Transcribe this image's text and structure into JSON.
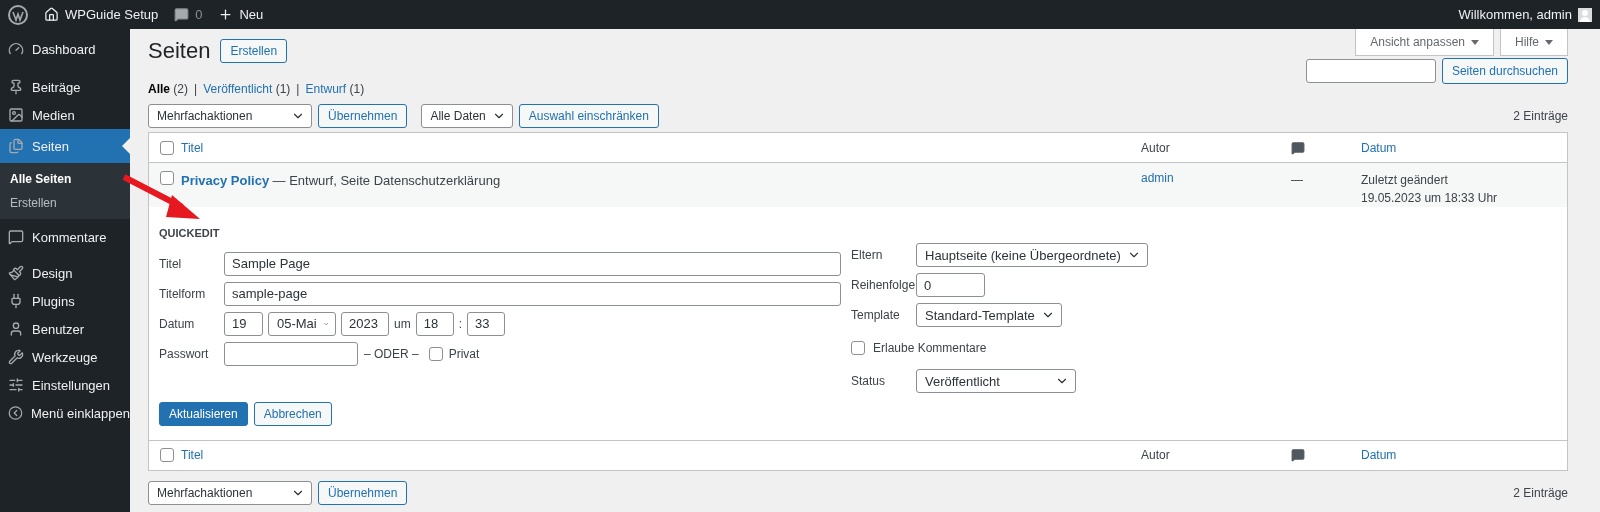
{
  "admin_bar": {
    "site": "WPGuide Setup",
    "comments": "0",
    "new": "Neu",
    "greeting": "Willkommen, admin"
  },
  "sidebar": {
    "items": [
      {
        "label": "Dashboard",
        "selected": false
      },
      {
        "label": "Beiträge",
        "selected": false
      },
      {
        "label": "Medien",
        "selected": false
      },
      {
        "label": "Seiten",
        "selected": true,
        "children": [
          {
            "label": "Alle Seiten",
            "selected": true
          },
          {
            "label": "Erstellen",
            "selected": false
          }
        ]
      },
      {
        "label": "Kommentare",
        "selected": false
      },
      {
        "label": "Design",
        "selected": false
      },
      {
        "label": "Plugins",
        "selected": false
      },
      {
        "label": "Benutzer",
        "selected": false
      },
      {
        "label": "Werkzeuge",
        "selected": false
      },
      {
        "label": "Einstellungen",
        "selected": false
      },
      {
        "label": "Menü einklappen",
        "selected": false
      }
    ]
  },
  "screen_options": [
    "Ansicht anpassen",
    "Hilfe"
  ],
  "heading": "Seiten",
  "add_button": "Erstellen",
  "views": [
    {
      "label": "Alle",
      "count": "(2)",
      "selected": true
    },
    {
      "separator": "|",
      "label": "Veröffentlicht",
      "count": "(1)",
      "selected": false
    },
    {
      "separator": "|",
      "label": "Entwurf",
      "count": "(1)",
      "selected": false
    }
  ],
  "search": {
    "button": "Seiten durchsuchen"
  },
  "top_actions": {
    "bulk": "Mehrfachaktionen",
    "apply": "Übernehmen",
    "dates": "Alle Daten",
    "filter": "Auswahl einschränken",
    "count": "2 Einträge"
  },
  "table": {
    "columns": [
      "Titel",
      "Autor",
      "Datum"
    ],
    "select_all": false,
    "footer_columns": [
      "Titel",
      "Autor",
      "Datum"
    ],
    "footer_select_all": false,
    "rows": [
      {
        "title": "Privacy Policy",
        "state": "— Entwurf, Seite Datenschutzerklärung",
        "author": "admin",
        "comments": "—",
        "date_label": "Zuletzt geändert",
        "date": "19.05.2023 um 18:33 Uhr",
        "checked": false
      }
    ]
  },
  "quick_edit": {
    "heading": "QUICKEDIT",
    "title_label": "Titel",
    "title": "Sample Page",
    "slug_label": "Titelform",
    "slug": "sample-page",
    "date_label": "Datum",
    "day": "19",
    "month": "05-Mai",
    "year": "2023",
    "at": "um",
    "hour": "18",
    "time_separator": ":",
    "minute": "33",
    "password_label": "Passwort",
    "or": "– ODER –",
    "private_label": "Privat",
    "private": false,
    "parent_label": "Eltern",
    "parent": "Hauptseite (keine Übergeordnete)",
    "order_label": "Reihenfolge",
    "order": "0",
    "template_label": "Template",
    "template": "Standard-Template",
    "comments_label": "Erlaube Kommentare",
    "comments": false,
    "status_label": "Status",
    "status": "Veröffentlicht",
    "update": "Aktualisieren",
    "cancel": "Abbrechen"
  },
  "bottom_actions": {
    "bulk": "Mehrfachaktionen",
    "apply": "Übernehmen",
    "count": "2 Einträge"
  }
}
